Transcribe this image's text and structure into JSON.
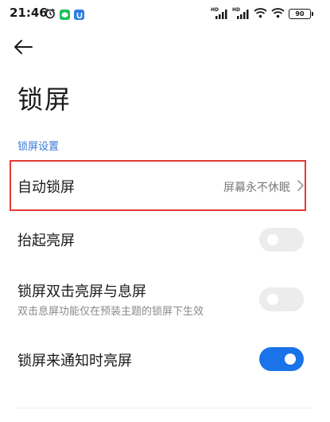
{
  "status_bar": {
    "time": "21:46",
    "battery": "90",
    "hd_label": "HD",
    "icons": [
      "alarm-icon",
      "wechat-icon",
      "app-badge-icon",
      "signal-hd-icon",
      "signal-hd-icon",
      "wifi-icon",
      "wifi-icon",
      "battery-icon"
    ]
  },
  "header": {
    "back_icon": "back-arrow-icon",
    "title": "锁屏"
  },
  "section": {
    "label": "锁屏设置"
  },
  "rows": [
    {
      "title": "自动锁屏",
      "value": "屏幕永不休眠",
      "type": "link",
      "highlighted": true
    },
    {
      "title": "抬起亮屏",
      "type": "toggle",
      "checked": false
    },
    {
      "title": "锁屏双击亮屏与息屏",
      "subtitle": "双击息屏功能仅在预装主题的锁屏下生效",
      "type": "toggle",
      "checked": false
    },
    {
      "title": "锁屏来通知时亮屏",
      "type": "toggle",
      "checked": true
    }
  ],
  "colors": {
    "accent": "#1a73e8",
    "section_label": "#3a7bd5",
    "highlight_border": "#e53935",
    "toggle_off": "#ececec"
  }
}
